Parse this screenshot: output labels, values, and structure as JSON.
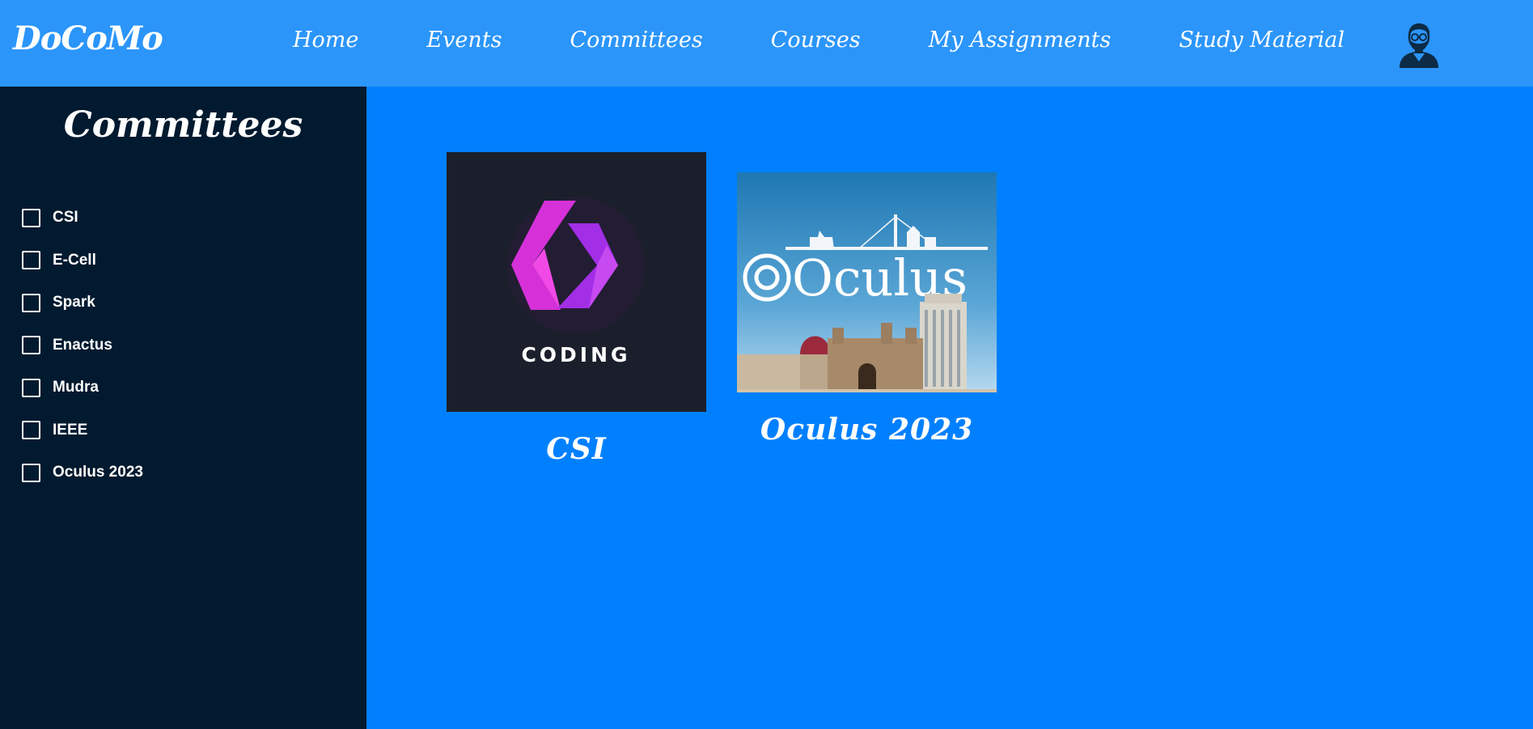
{
  "navbar": {
    "brand": "DoCoMo",
    "links": [
      "Home",
      "Events",
      "Committees",
      "Courses",
      "My Assignments",
      "Study Material"
    ],
    "avatar_icon": "user-avatar-icon"
  },
  "sidebar": {
    "title": "Committees",
    "filters": [
      "CSI",
      "E-Cell",
      "Spark",
      "Enactus",
      "Mudra",
      "IEEE",
      "Oculus 2023"
    ]
  },
  "cards": [
    {
      "title": "CSI",
      "image_text": "CODING"
    },
    {
      "title": "Oculus 2023",
      "image_text": "Oculus"
    }
  ],
  "colors": {
    "navbar_bg": "#2b95fa",
    "main_bg": "#0080fe",
    "sidebar_bg": "#021a2f",
    "csi_logo_bg": "#1b1f2b",
    "csi_logo_accent": "#e23ce6"
  }
}
